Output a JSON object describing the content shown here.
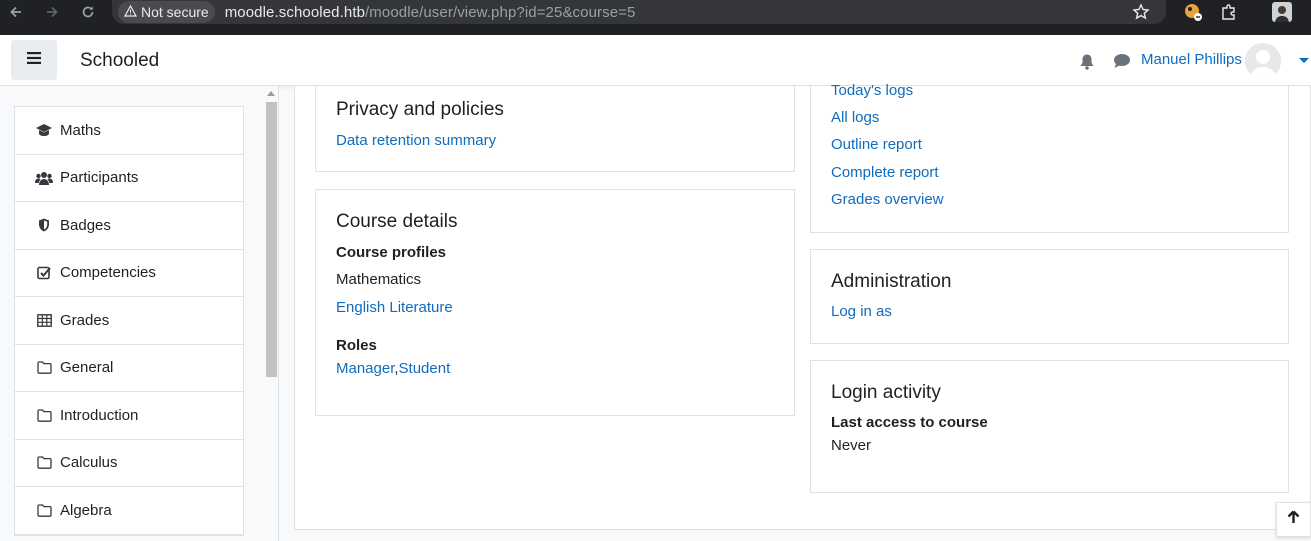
{
  "browser": {
    "security_label": "Not secure",
    "url_host": "moodle.schooled.htb",
    "url_path": "/moodle/user/view.php?id=25&course=5"
  },
  "navbar": {
    "site_name": "Schooled",
    "user_name": "Manuel Phillips"
  },
  "sidebar": {
    "items": [
      {
        "label": "Maths",
        "icon": "graduation-cap-icon"
      },
      {
        "label": "Participants",
        "icon": "users-icon"
      },
      {
        "label": "Badges",
        "icon": "shield-icon"
      },
      {
        "label": "Competencies",
        "icon": "check-square-icon"
      },
      {
        "label": "Grades",
        "icon": "table-icon"
      },
      {
        "label": "General",
        "icon": "folder-icon"
      },
      {
        "label": "Introduction",
        "icon": "folder-icon"
      },
      {
        "label": "Calculus",
        "icon": "folder-icon"
      },
      {
        "label": "Algebra",
        "icon": "folder-icon"
      }
    ]
  },
  "privacy": {
    "title": "Privacy and policies",
    "link": "Data retention summary"
  },
  "course_details": {
    "title": "Course details",
    "profiles_label": "Course profiles",
    "profile_current": "Mathematics",
    "profile_link": "English Literature",
    "roles_label": "Roles",
    "role_1": "Manager",
    "separator": ",",
    "role_2": "Student"
  },
  "reports": {
    "links": [
      "Today's logs",
      "All logs",
      "Outline report",
      "Complete report",
      "Grades overview"
    ]
  },
  "administration": {
    "title": "Administration",
    "link": "Log in as"
  },
  "login_activity": {
    "title": "Login activity",
    "label": "Last access to course",
    "value": "Never"
  },
  "colors": {
    "link": "#0f6cbf",
    "chrome_bg": "#202124",
    "border": "#dee2e6"
  }
}
